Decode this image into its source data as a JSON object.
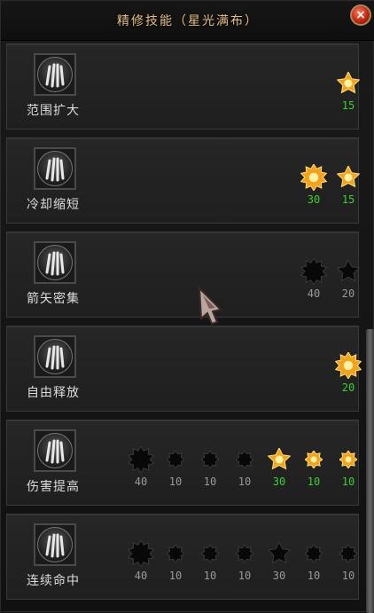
{
  "window": {
    "title": "精修技能（星光满布）",
    "close_label": "×"
  },
  "colors": {
    "lit_value": "#3ccf31",
    "dim_value": "#9a9a9a",
    "title": "#e6c084"
  },
  "skills": [
    {
      "name": "范围扩大",
      "icon": "claw-skill-icon",
      "nodes": [
        {
          "value": "15",
          "state": "lit",
          "size": "small"
        }
      ]
    },
    {
      "name": "冷却缩短",
      "icon": "claw-skill-icon",
      "nodes": [
        {
          "value": "30",
          "state": "lit",
          "size": "big"
        },
        {
          "value": "15",
          "state": "lit",
          "size": "small"
        }
      ]
    },
    {
      "name": "箭矢密集",
      "icon": "claw-skill-icon",
      "nodes": [
        {
          "value": "40",
          "state": "dim",
          "size": "big"
        },
        {
          "value": "20",
          "state": "dim",
          "size": "small"
        }
      ]
    },
    {
      "name": "自由释放",
      "icon": "claw-skill-icon",
      "nodes": [
        {
          "value": "20",
          "state": "lit",
          "size": "big"
        }
      ]
    },
    {
      "name": "伤害提高",
      "icon": "claw-skill-icon",
      "nodes": [
        {
          "value": "40",
          "state": "dim",
          "size": "big"
        },
        {
          "value": "10",
          "state": "dim",
          "size": "tiny"
        },
        {
          "value": "10",
          "state": "dim",
          "size": "tiny"
        },
        {
          "value": "10",
          "state": "dim",
          "size": "tiny"
        },
        {
          "value": "30",
          "state": "lit",
          "size": "small"
        },
        {
          "value": "10",
          "state": "lit",
          "size": "tiny"
        },
        {
          "value": "10",
          "state": "lit",
          "size": "tiny"
        }
      ]
    },
    {
      "name": "连续命中",
      "icon": "claw-skill-icon",
      "nodes": [
        {
          "value": "40",
          "state": "dim",
          "size": "big"
        },
        {
          "value": "10",
          "state": "dim",
          "size": "tiny"
        },
        {
          "value": "10",
          "state": "dim",
          "size": "tiny"
        },
        {
          "value": "10",
          "state": "dim",
          "size": "tiny"
        },
        {
          "value": "30",
          "state": "dim",
          "size": "small"
        },
        {
          "value": "10",
          "state": "dim",
          "size": "tiny"
        },
        {
          "value": "10",
          "state": "dim",
          "size": "tiny"
        }
      ]
    }
  ]
}
